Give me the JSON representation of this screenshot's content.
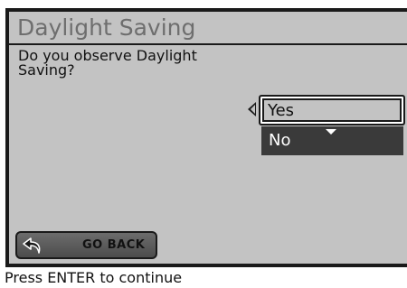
{
  "screen": {
    "title": "Daylight Saving",
    "question_line1": "Do you observe Daylight",
    "question_line2": "Saving?",
    "options": [
      {
        "label": "Yes",
        "state": "focused"
      },
      {
        "label": "No",
        "state": "highlighted"
      }
    ],
    "go_back_label": "GO BACK"
  },
  "footer": {
    "hint": "Press ENTER to continue"
  },
  "icons": {
    "left_arrow": "chevron-left-icon",
    "down_arrow": "chevron-down-icon",
    "back": "back-arrow-icon"
  },
  "colors": {
    "screen_bg": "#c3c3c3",
    "title_text": "#6e6e6e",
    "selected_option_bg": "#3a3a3a",
    "button_bg": "#5c5c5c"
  }
}
